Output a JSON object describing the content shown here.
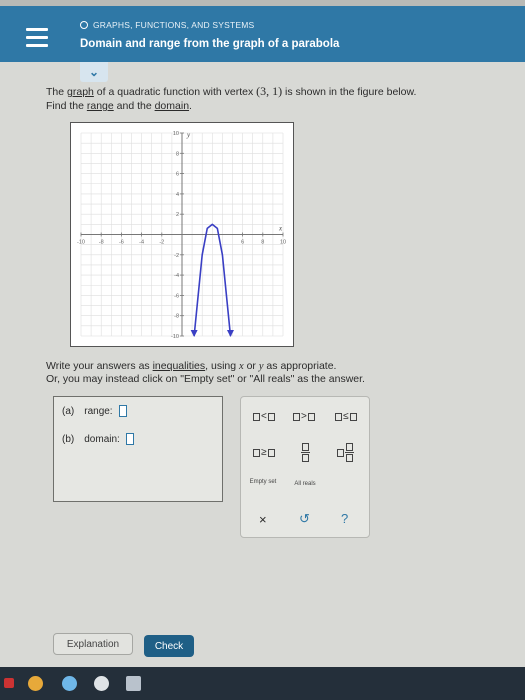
{
  "header": {
    "breadcrumb": "GRAPHS, FUNCTIONS, AND SYSTEMS",
    "title": "Domain and range from the graph of a parabola"
  },
  "question": {
    "text_1": "The ",
    "link_graph": "graph",
    "text_2": " of a quadratic function with vertex ",
    "vertex": "(3, 1)",
    "text_3": " is shown in the figure below.",
    "text_4": "Find the ",
    "link_range": "range",
    "text_5": " and the ",
    "link_domain": "domain",
    "text_6": "."
  },
  "chart_data": {
    "type": "line",
    "title": "",
    "xlabel": "x",
    "ylabel": "y",
    "xlim": [
      -10,
      10
    ],
    "ylim": [
      -10,
      10
    ],
    "x_ticks": [
      "-10",
      "-8",
      "-6",
      "-4",
      "-2",
      "6",
      "8",
      "10"
    ],
    "y_ticks": [
      "10",
      "8",
      "6",
      "4",
      "2",
      "-2",
      "-4",
      "-6",
      "-8",
      "-10"
    ],
    "grid": true,
    "series": [
      {
        "x": [
          1.2,
          1.5,
          2,
          2.5,
          3,
          3.5,
          4,
          4.5,
          4.8
        ],
        "y": [
          -10,
          -7,
          -2,
          0.6,
          1,
          0.6,
          -2,
          -7,
          -10
        ]
      }
    ],
    "colors": {
      "curve": "#3a3fc4"
    }
  },
  "instructions": {
    "line1_a": "Write your answers as ",
    "line1_link": "inequalities",
    "line1_b": ", using ",
    "var_x": "x",
    "line1_c": " or ",
    "var_y": "y",
    "line1_d": " as appropriate.",
    "line2": "Or, you may instead click on \"Empty set\" or \"All reals\" as the answer."
  },
  "answers": {
    "a_label": "(a)",
    "a_name": "range:",
    "b_label": "(b)",
    "b_name": "domain:"
  },
  "keypad": {
    "lt": "<",
    "gt": ">",
    "le": "≤",
    "ge": "≥",
    "empty_set": "Empty set",
    "all_reals": "All reals",
    "clear": "×",
    "undo": "↺",
    "help": "?"
  },
  "buttons": {
    "explanation": "Explanation",
    "check": "Check"
  }
}
